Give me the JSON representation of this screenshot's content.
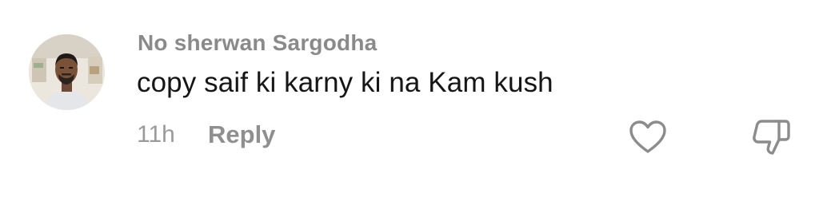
{
  "comment": {
    "username": "No sherwan Sargodha",
    "text": "copy saif ki karny ki na Kam kush",
    "timestamp": "11h",
    "reply_label": "Reply"
  },
  "icons": {
    "like": "heart-outline-icon",
    "dislike": "thumbs-down-outline-icon"
  },
  "colors": {
    "username": "#8a8a8a",
    "text": "#161616",
    "meta": "#9a9a9a",
    "icon_stroke": "#8c8c8c"
  }
}
